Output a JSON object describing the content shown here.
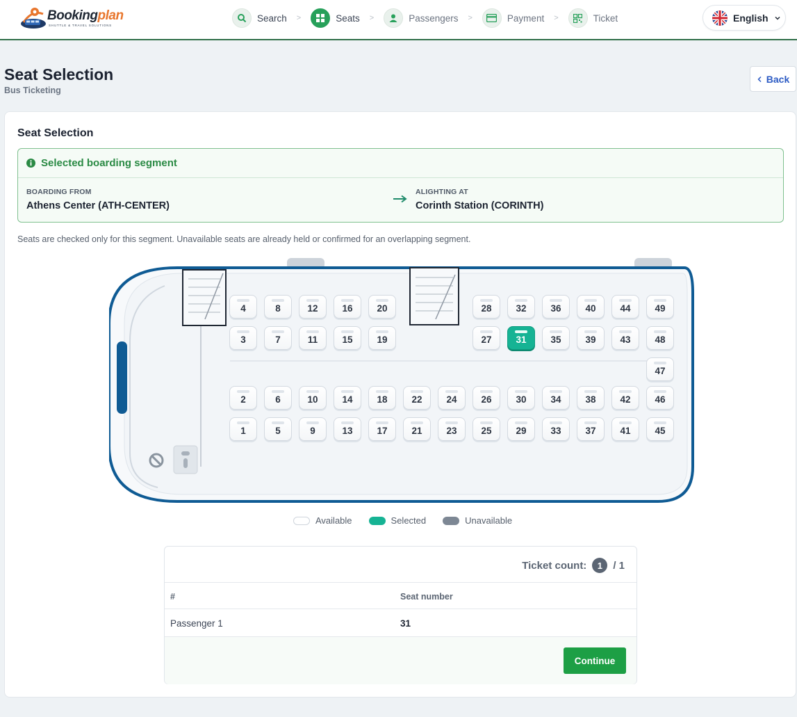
{
  "brand": {
    "name_a": "Booking",
    "name_b": "plan",
    "tagline": "SHUTTLE & TRAVEL SOLUTIONS"
  },
  "steps": [
    {
      "label": "Search",
      "icon": "search-icon"
    },
    {
      "label": "Seats",
      "icon": "seat-grid-icon"
    },
    {
      "label": "Passengers",
      "icon": "user-icon"
    },
    {
      "label": "Payment",
      "icon": "credit-card-icon"
    },
    {
      "label": "Ticket",
      "icon": "qr-code-icon"
    }
  ],
  "language": {
    "label": "English",
    "flag": "uk-flag-icon"
  },
  "page": {
    "title": "Seat Selection",
    "subtitle": "Bus Ticketing",
    "back_label": "Back"
  },
  "card": {
    "title": "Seat Selection",
    "segment": {
      "heading": "Selected boarding segment",
      "boarding_label": "BOARDING FROM",
      "boarding_value": "Athens Center (ATH-CENTER)",
      "alighting_label": "ALIGHTING AT",
      "alighting_value": "Corinth Station (CORINTH)"
    },
    "note": "Seats are checked only for this segment. Unavailable seats are already held or confirmed for an overlapping segment."
  },
  "seat_map": {
    "row_top": [
      "4",
      "8",
      "12",
      "16",
      "20",
      "28",
      "32",
      "36",
      "40",
      "44",
      "49"
    ],
    "row_2": [
      "3",
      "7",
      "11",
      "15",
      "19",
      "27",
      "31",
      "35",
      "39",
      "43",
      "48"
    ],
    "row_mid": [
      "47"
    ],
    "row_4": [
      "2",
      "6",
      "10",
      "14",
      "18",
      "22",
      "24",
      "26",
      "30",
      "34",
      "38",
      "42",
      "46"
    ],
    "row_bottom": [
      "1",
      "5",
      "9",
      "13",
      "17",
      "21",
      "23",
      "25",
      "29",
      "33",
      "37",
      "41",
      "45"
    ],
    "selected": [
      "31"
    ],
    "colors": {
      "available": "#ffffff",
      "selected": "#16b394",
      "unavailable": "#7d8794",
      "bus_outline": "#0f5b94"
    }
  },
  "legend": {
    "available": "Available",
    "selected": "Selected",
    "unavailable": "Unavailable"
  },
  "tickets": {
    "count_label": "Ticket count:",
    "count": "1",
    "total": "/ 1",
    "col_num": "#",
    "col_seat": "Seat number",
    "rows": [
      {
        "passenger": "Passenger 1",
        "seat": "31"
      }
    ],
    "continue_label": "Continue"
  }
}
